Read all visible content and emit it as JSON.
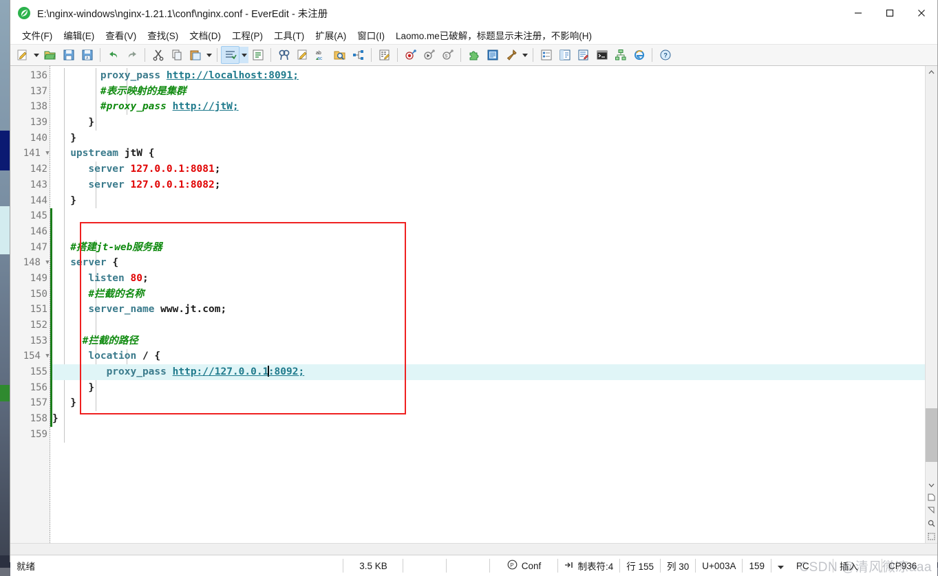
{
  "window": {
    "title": "E:\\nginx-windows\\nginx-1.21.1\\conf\\nginx.conf - EverEdit - 未注册",
    "app_icon": "everedit-leaf-icon",
    "buttons": {
      "minimize": "–",
      "maximize": "□",
      "close": "✕"
    }
  },
  "menubar": {
    "items": [
      {
        "label": "文件(F)"
      },
      {
        "label": "编辑(E)"
      },
      {
        "label": "查看(V)"
      },
      {
        "label": "查找(S)"
      },
      {
        "label": "文档(D)"
      },
      {
        "label": "工程(P)"
      },
      {
        "label": "工具(T)"
      },
      {
        "label": "扩展(A)"
      },
      {
        "label": "窗口(I)"
      },
      {
        "label": "Laomo.me已破解，标题显示未注册，不影响(H)"
      }
    ]
  },
  "toolbar": {
    "groups": [
      {
        "items": [
          {
            "name": "new-file-icon",
            "tip": "新建"
          },
          {
            "name": "new-file-dropdown-icon",
            "tip": "新建下拉"
          },
          {
            "name": "open-file-icon",
            "tip": "打开"
          },
          {
            "name": "save-icon",
            "tip": "保存"
          },
          {
            "name": "save-as-icon",
            "tip": "另存为"
          }
        ]
      },
      {
        "items": [
          {
            "name": "undo-icon",
            "tip": "撤销"
          },
          {
            "name": "redo-icon",
            "tip": "重做"
          }
        ]
      },
      {
        "items": [
          {
            "name": "cut-icon",
            "tip": "剪切"
          },
          {
            "name": "copy-icon",
            "tip": "复制"
          },
          {
            "name": "paste-icon",
            "tip": "粘贴"
          },
          {
            "name": "paste-dropdown-icon",
            "tip": "粘贴下拉"
          }
        ]
      },
      {
        "items": [
          {
            "name": "line-ops-icon",
            "tip": "行操作",
            "active": true
          },
          {
            "name": "line-ops-dropdown-icon",
            "tip": "行操作下拉",
            "active": true
          },
          {
            "name": "format-lines-icon",
            "tip": "格式化"
          }
        ]
      },
      {
        "items": [
          {
            "name": "find-icon",
            "tip": "查找"
          },
          {
            "name": "replace-icon",
            "tip": "替换"
          },
          {
            "name": "sort-abc-icon",
            "tip": "排序"
          },
          {
            "name": "find-in-files-icon",
            "tip": "文件中查找"
          },
          {
            "name": "jump-icon",
            "tip": "跳转"
          }
        ]
      },
      {
        "items": [
          {
            "name": "compare-icon",
            "tip": "比较"
          }
        ]
      },
      {
        "items": [
          {
            "name": "record-macro-icon",
            "tip": "录制宏"
          },
          {
            "name": "play-macro-icon",
            "tip": "播放宏"
          },
          {
            "name": "macro-manage-icon",
            "tip": "宏管理"
          }
        ]
      },
      {
        "items": [
          {
            "name": "plugin-icon",
            "tip": "插件"
          },
          {
            "name": "document-icon",
            "tip": "文档"
          },
          {
            "name": "build-tool-icon",
            "tip": "工具"
          },
          {
            "name": "build-tool-dropdown-icon",
            "tip": "工具下拉"
          }
        ]
      },
      {
        "items": [
          {
            "name": "outline-panel-icon",
            "tip": "大纲"
          },
          {
            "name": "explorer-panel-icon",
            "tip": "资源管理"
          },
          {
            "name": "clipboard-panel-icon",
            "tip": "剪贴板"
          },
          {
            "name": "console-panel-icon",
            "tip": "控制台"
          },
          {
            "name": "sitemap-icon",
            "tip": "站点"
          },
          {
            "name": "browser-icon",
            "tip": "浏览器预览"
          }
        ]
      },
      {
        "items": [
          {
            "name": "help-icon",
            "tip": "帮助"
          }
        ]
      }
    ]
  },
  "editor": {
    "first_line": 136,
    "current_line": 155,
    "fold_lines": [
      141,
      148,
      154
    ],
    "lines": [
      {
        "n": 136,
        "tokens": [
          {
            "t": "        ",
            "c": "plain"
          },
          {
            "t": "proxy_pass",
            "c": "k"
          },
          {
            "t": " ",
            "c": "plain"
          },
          {
            "t": "http://localhost:8091;",
            "c": "url"
          }
        ]
      },
      {
        "n": 137,
        "tokens": [
          {
            "t": "        ",
            "c": "plain"
          },
          {
            "t": "#表示映射的是集群",
            "c": "cmt"
          }
        ]
      },
      {
        "n": 138,
        "tokens": [
          {
            "t": "        ",
            "c": "plain"
          },
          {
            "t": "#proxy_pass",
            "c": "cmt"
          },
          {
            "t": " ",
            "c": "plain"
          },
          {
            "t": "http://jtW;",
            "c": "url"
          }
        ]
      },
      {
        "n": 139,
        "tokens": [
          {
            "t": "      ",
            "c": "plain"
          },
          {
            "t": "}",
            "c": "brace"
          }
        ]
      },
      {
        "n": 140,
        "tokens": [
          {
            "t": "   ",
            "c": "plain"
          },
          {
            "t": "}",
            "c": "brace"
          }
        ]
      },
      {
        "n": 141,
        "tokens": [
          {
            "t": "   ",
            "c": "plain"
          },
          {
            "t": "upstream",
            "c": "kw"
          },
          {
            "t": " jtW {",
            "c": "plain"
          }
        ]
      },
      {
        "n": 142,
        "tokens": [
          {
            "t": "      ",
            "c": "plain"
          },
          {
            "t": "server",
            "c": "kw"
          },
          {
            "t": " ",
            "c": "plain"
          },
          {
            "t": "127.0.0.1:8081",
            "c": "num"
          },
          {
            "t": ";",
            "c": "plain"
          }
        ]
      },
      {
        "n": 143,
        "tokens": [
          {
            "t": "      ",
            "c": "plain"
          },
          {
            "t": "server",
            "c": "kw"
          },
          {
            "t": " ",
            "c": "plain"
          },
          {
            "t": "127.0.0.1:8082",
            "c": "num"
          },
          {
            "t": ";",
            "c": "plain"
          }
        ]
      },
      {
        "n": 144,
        "tokens": [
          {
            "t": "   ",
            "c": "plain"
          },
          {
            "t": "}",
            "c": "brace"
          }
        ]
      },
      {
        "n": 145,
        "tokens": []
      },
      {
        "n": 146,
        "tokens": []
      },
      {
        "n": 147,
        "tokens": [
          {
            "t": "   ",
            "c": "plain"
          },
          {
            "t": "#搭建jt-web服务器",
            "c": "cmt"
          }
        ]
      },
      {
        "n": 148,
        "tokens": [
          {
            "t": "   ",
            "c": "plain"
          },
          {
            "t": "server",
            "c": "kw"
          },
          {
            "t": " {",
            "c": "plain"
          }
        ]
      },
      {
        "n": 149,
        "tokens": [
          {
            "t": "      ",
            "c": "plain"
          },
          {
            "t": "listen",
            "c": "kw"
          },
          {
            "t": " ",
            "c": "plain"
          },
          {
            "t": "80",
            "c": "num"
          },
          {
            "t": ";",
            "c": "plain"
          }
        ]
      },
      {
        "n": 150,
        "tokens": [
          {
            "t": "      ",
            "c": "plain"
          },
          {
            "t": "#拦截的名称",
            "c": "cmt"
          }
        ]
      },
      {
        "n": 151,
        "tokens": [
          {
            "t": "      ",
            "c": "plain"
          },
          {
            "t": "server_name",
            "c": "kw"
          },
          {
            "t": " www.jt.com;",
            "c": "plain"
          }
        ]
      },
      {
        "n": 152,
        "tokens": []
      },
      {
        "n": 153,
        "tokens": [
          {
            "t": "     ",
            "c": "plain"
          },
          {
            "t": "#拦截的路径",
            "c": "cmt"
          }
        ]
      },
      {
        "n": 154,
        "tokens": [
          {
            "t": "      ",
            "c": "plain"
          },
          {
            "t": "location",
            "c": "kw"
          },
          {
            "t": " / {",
            "c": "plain"
          }
        ]
      },
      {
        "n": 155,
        "tokens": [
          {
            "t": "         ",
            "c": "plain"
          },
          {
            "t": "proxy_pass",
            "c": "k"
          },
          {
            "t": " ",
            "c": "plain"
          },
          {
            "t": "http://127.0.0.1",
            "c": "url"
          },
          {
            "t": "|CARET|",
            "c": "caret"
          },
          {
            "t": ":8092;",
            "c": "url"
          }
        ]
      },
      {
        "n": 156,
        "tokens": [
          {
            "t": "      ",
            "c": "plain"
          },
          {
            "t": "}",
            "c": "brace"
          }
        ]
      },
      {
        "n": 157,
        "tokens": [
          {
            "t": "   ",
            "c": "plain"
          },
          {
            "t": "}",
            "c": "brace"
          }
        ]
      },
      {
        "n": 158,
        "tokens": [
          {
            "t": "",
            "c": "plain"
          },
          {
            "t": "}",
            "c": "brace"
          }
        ]
      },
      {
        "n": 159,
        "tokens": []
      }
    ],
    "annotation": {
      "type": "red-rectangle",
      "color": "#ef2020",
      "covers_lines": "146-157"
    }
  },
  "statusbar": {
    "state": "就绪",
    "file_size": "3.5 KB",
    "syntax": "Conf",
    "syntax_icon": "conf-badge-icon",
    "tab_icon": "tab-arrow-icon",
    "tab_width": "制表符:4",
    "row": "行 155",
    "col": "列 30",
    "unicode": "U+003A",
    "char_code": "159",
    "dropdown_icon": "chevron-down-icon",
    "platform": "PC",
    "insert_mode": "插入",
    "encoding": "CP936"
  },
  "watermark": "CSDN @清风微凉aaa",
  "colors": {
    "accent_red": "#ef2020",
    "comment_green": "#0f8a0f",
    "keyword_teal": "#3b7b8c",
    "number_red": "#e00000",
    "url_teal": "#1f7a8c",
    "current_line": "#e0f5f7",
    "change_marker": "#1a7d1a"
  }
}
